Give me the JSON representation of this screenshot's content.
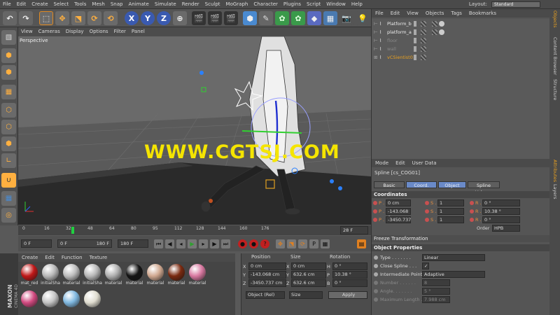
{
  "menus": [
    "File",
    "Edit",
    "Create",
    "Select",
    "Tools",
    "Mesh",
    "Snap",
    "Animate",
    "Simulate",
    "Render",
    "Sculpt",
    "MoGraph",
    "Character",
    "Plugins",
    "Script",
    "Window",
    "Help"
  ],
  "layout": {
    "label": "Layout:",
    "value": "Standard"
  },
  "viewport": {
    "menus": [
      "View",
      "Cameras",
      "Display",
      "Options",
      "Filter",
      "Panel"
    ],
    "camera": "Perspective",
    "watermark": "WWW.CGTSJ.COM"
  },
  "timeline": {
    "ticks": [
      "0",
      "16",
      "32",
      "48",
      "64",
      "80",
      "95",
      "112",
      "128",
      "144",
      "160",
      "176"
    ],
    "current": "28 F"
  },
  "transport": {
    "start": "0 F",
    "cur": "0 F",
    "end": "180 F",
    "end2": "180 F"
  },
  "materials": {
    "menus": [
      "Create",
      "Edit",
      "Function",
      "Texture"
    ],
    "items": [
      {
        "label": "mat_red",
        "color": "#c01818"
      },
      {
        "label": "initialSha",
        "color": "#b8b8b8"
      },
      {
        "label": "material",
        "color": "#bdbdbd"
      },
      {
        "label": "initialSha",
        "color": "#b8b8b8"
      },
      {
        "label": "material",
        "color": "#b0b0b0"
      },
      {
        "label": "material",
        "color": "#151515"
      },
      {
        "label": "material",
        "color": "#d0a890"
      },
      {
        "label": "material",
        "color": "#7a2a10"
      },
      {
        "label": "material",
        "color": "#d878a0"
      },
      {
        "label": "",
        "color": "#d24a80"
      },
      {
        "label": "",
        "color": "#c4c4c4"
      },
      {
        "label": "",
        "color": "#80b8e0"
      },
      {
        "label": "",
        "color": "#e0ddd0"
      }
    ]
  },
  "coords": {
    "headers": [
      "Position",
      "Size",
      "Rotation"
    ],
    "rows": [
      {
        "a": "X",
        "pos": "0 cm",
        "size": "0 cm",
        "r": "H",
        "rot": "0 °"
      },
      {
        "a": "Y",
        "pos": "-143.068 cm",
        "size": "632.6 cm",
        "r": "P",
        "rot": "10.38 °"
      },
      {
        "a": "Z",
        "pos": "-3450.737 cm",
        "size": "632.6 cm",
        "r": "B",
        "rot": "0 °"
      }
    ],
    "mode": "Object (Rel)",
    "sizemode": "Size",
    "apply": "Apply"
  },
  "objects": {
    "menus": [
      "File",
      "Edit",
      "View",
      "Objects",
      "Tags",
      "Bookmarks"
    ],
    "items": [
      "Platform_b",
      "platform_a",
      "floor",
      "wall",
      "vCSientist01"
    ]
  },
  "attributes": {
    "menu": [
      "Mode",
      "Edit",
      "User Data"
    ],
    "object_name": "Spline [cs_COG01]",
    "tabs": [
      "Basic",
      "Coord.",
      "Object",
      "Spline Volume"
    ],
    "coord_title": "Coordinates",
    "coord_rows": [
      {
        "p": "P . X",
        "pv": "0 cm",
        "s": "S . X",
        "sv": "1",
        "r": "R . H",
        "rv": "0 °"
      },
      {
        "p": "P . Y",
        "pv": "-143.068 c",
        "s": "S . Y",
        "sv": "1",
        "r": "R . P",
        "rv": "10.38 °"
      },
      {
        "p": "P . Z",
        "pv": "-3450.737",
        "s": "S . Z",
        "sv": "1",
        "r": "R . B",
        "rv": "0 °"
      }
    ],
    "order_label": "Order",
    "order": "HPB",
    "freeze": "Freeze Transformation",
    "objprops_title": "Object Properties",
    "props": [
      {
        "label": "Type . . . . . . .",
        "value": "Linear"
      },
      {
        "label": "Close Spline . . .",
        "value": "✓"
      },
      {
        "label": "Intermediate Points",
        "value": "Adaptive"
      },
      {
        "label": "Number . . . . . .",
        "value": "8"
      },
      {
        "label": "Angle. . . . . . .",
        "value": "5 °"
      },
      {
        "label": "Maximum Length . .",
        "value": "7.988 cm"
      }
    ]
  },
  "sidetabs": [
    "Objects",
    "Content Browser",
    "Structure",
    "Attributes",
    "Layers"
  ]
}
